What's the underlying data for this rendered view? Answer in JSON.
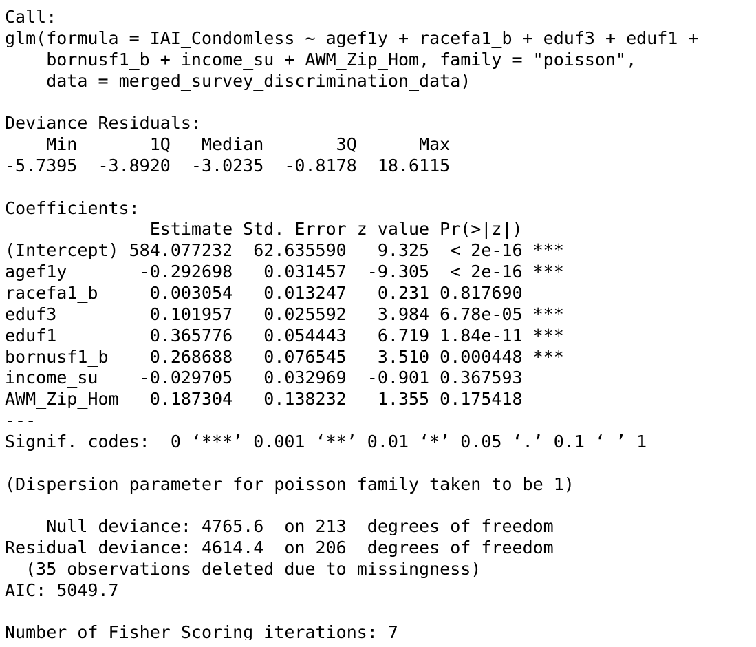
{
  "console": {
    "lines": [
      "Call:",
      "glm(formula = IAI_Condomless ~ agef1y + racefa1_b + eduf3 + eduf1 +",
      "    bornusf1_b + income_su + AWM_Zip_Hom, family = \"poisson\",",
      "    data = merged_survey_discrimination_data)",
      "",
      "Deviance Residuals:",
      "    Min       1Q   Median       3Q      Max",
      "-5.7395  -3.8920  -3.0235  -0.8178  18.6115",
      "",
      "Coefficients:",
      "              Estimate Std. Error z value Pr(>|z|)",
      "(Intercept) 584.077232  62.635590   9.325  < 2e-16 ***",
      "agef1y       -0.292698   0.031457  -9.305  < 2e-16 ***",
      "racefa1_b     0.003054   0.013247   0.231 0.817690",
      "eduf3         0.101957   0.025592   3.984 6.78e-05 ***",
      "eduf1         0.365776   0.054443   6.719 1.84e-11 ***",
      "bornusf1_b    0.268688   0.076545   3.510 0.000448 ***",
      "income_su    -0.029705   0.032969  -0.901 0.367593",
      "AWM_Zip_Hom   0.187304   0.138232   1.355 0.175418",
      "---",
      "Signif. codes:  0 ‘***’ 0.001 ‘**’ 0.01 ‘*’ 0.05 ‘.’ 0.1 ‘ ’ 1",
      "",
      "(Dispersion parameter for poisson family taken to be 1)",
      "",
      "    Null deviance: 4765.6  on 213  degrees of freedom",
      "Residual deviance: 4614.4  on 206  degrees of freedom",
      "  (35 observations deleted due to missingness)",
      "AIC: 5049.7",
      "",
      "Number of Fisher Scoring iterations: 7"
    ]
  }
}
